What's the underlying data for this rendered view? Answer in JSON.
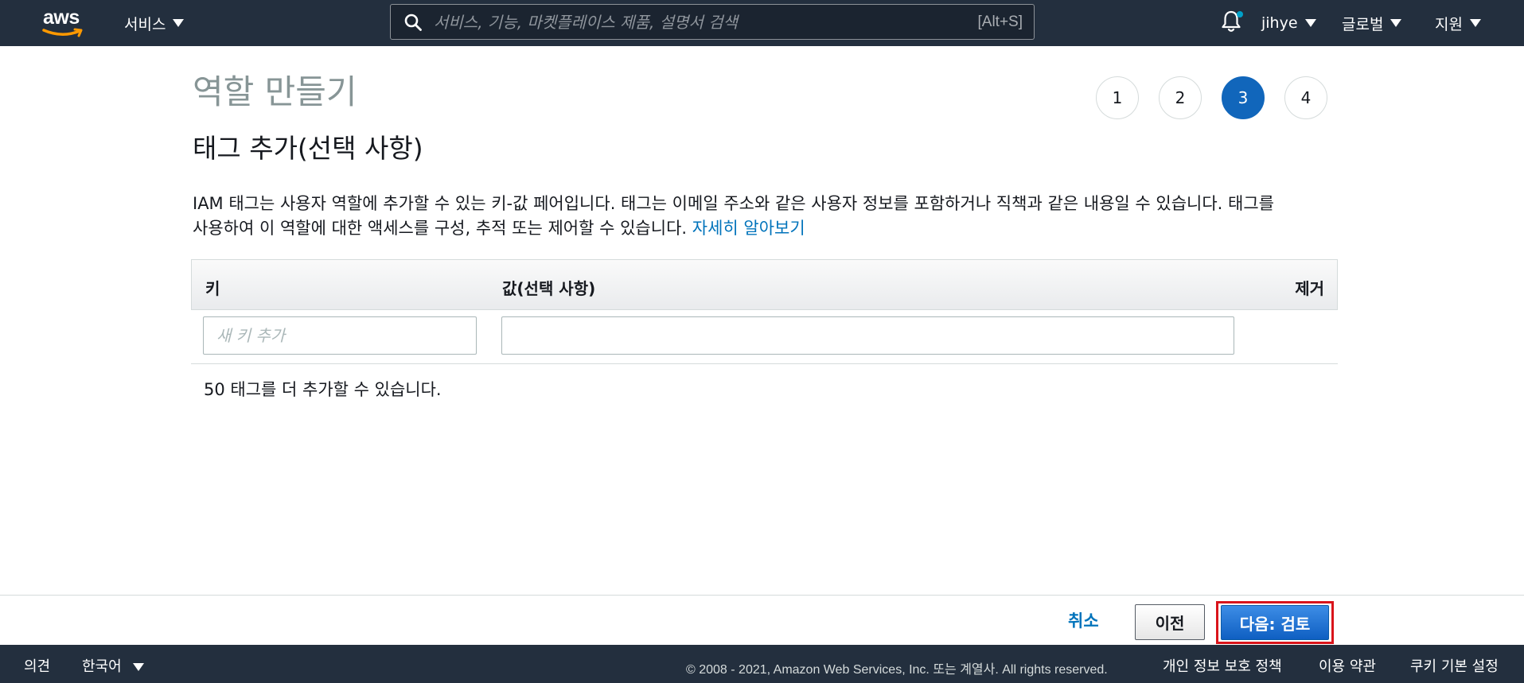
{
  "topnav": {
    "services_label": "서비스",
    "search_placeholder": "서비스, 기능, 마켓플레이스 제품, 설명서 검색",
    "search_shortcut": "[Alt+S]",
    "user_label": "jihye",
    "region_label": "글로벌",
    "support_label": "지원",
    "logo_text": "aws"
  },
  "page": {
    "title": "역할 만들기",
    "steps": [
      "1",
      "2",
      "3",
      "4"
    ],
    "active_step": 3,
    "section_title": "태그 추가(선택 사항)",
    "description_line1": "IAM 태그는 사용자 역할에 추가할 수 있는 키-값 페어입니다. 태그는 이메일 주소와 같은 사용자 정보를 포함하거나 직책과 같은 내용일 수 있습니다. 태그를",
    "description_line2": "사용하여 이 역할에 대한 액세스를 구성, 추적 또는 제어할 수 있습니다. ",
    "learn_more": "자세히 알아보기"
  },
  "tags_table": {
    "headers": {
      "key": "키",
      "value": "값(선택 사항)",
      "remove": "제거"
    },
    "key_placeholder": "새 키 추가",
    "value_text": "",
    "remaining": "50 태그를 더 추가할 수 있습니다."
  },
  "actions": {
    "cancel": "취소",
    "previous": "이전",
    "next": "다음: 검토"
  },
  "footer": {
    "feedback": "의견",
    "language": "한국어",
    "copyright": "© 2008 - 2021, Amazon Web Services, Inc. 또는 계열사. All rights reserved.",
    "privacy": "개인 정보 보호 정책",
    "terms": "이용 약관",
    "cookies": "쿠키 기본 설정"
  },
  "colors": {
    "nav_bg": "#232f3e",
    "accent_blue": "#1166bb",
    "link_blue": "#0073bb",
    "highlight_red": "#d9141b",
    "aws_orange": "#ff9900"
  }
}
